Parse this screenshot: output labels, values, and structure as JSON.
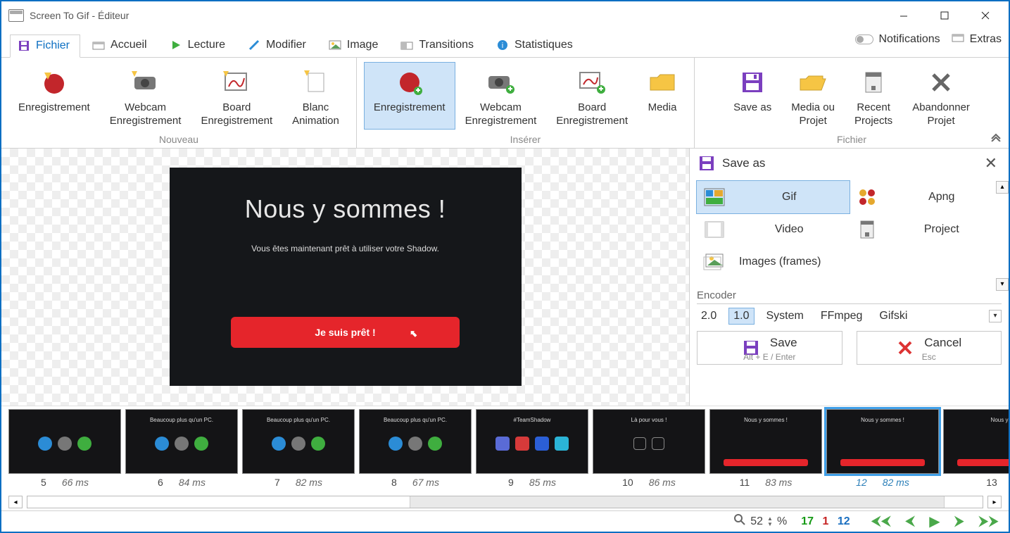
{
  "window": {
    "title": "Screen To Gif - Éditeur"
  },
  "tabs": {
    "fichier": "Fichier",
    "accueil": "Accueil",
    "lecture": "Lecture",
    "modifier": "Modifier",
    "image": "Image",
    "transitions": "Transitions",
    "statistiques": "Statistiques"
  },
  "ribbon_right": {
    "notifications": "Notifications",
    "extras": "Extras"
  },
  "ribbon": {
    "nouveau": {
      "label": "Nouveau",
      "items": {
        "rec": "Enregistrement",
        "webcam_l1": "Webcam",
        "webcam_l2": "Enregistrement",
        "board_l1": "Board",
        "board_l2": "Enregistrement",
        "blanc_l1": "Blanc",
        "blanc_l2": "Animation"
      }
    },
    "inserer": {
      "label": "Insérer",
      "items": {
        "rec": "Enregistrement",
        "webcam_l1": "Webcam",
        "webcam_l2": "Enregistrement",
        "board_l1": "Board",
        "board_l2": "Enregistrement",
        "media": "Media"
      }
    },
    "fichier_grp": {
      "label": "Fichier",
      "items": {
        "saveas": "Save as",
        "media_l1": "Media ou",
        "media_l2": "Projet",
        "recent_l1": "Recent",
        "recent_l2": "Projects",
        "abandon_l1": "Abandonner",
        "abandon_l2": "Projet"
      }
    }
  },
  "preview": {
    "heading": "Nous y sommes !",
    "sub": "Vous êtes maintenant prêt à utiliser votre Shadow.",
    "button": "Je suis prêt !"
  },
  "side": {
    "title": "Save as",
    "formats": {
      "gif": "Gif",
      "apng": "Apng",
      "video": "Video",
      "project": "Project",
      "images": "Images (frames)"
    },
    "encoder_label": "Encoder",
    "encoders": {
      "v20": "2.0",
      "v10": "1.0",
      "system": "System",
      "ffmpeg": "FFmpeg",
      "gifski": "Gifski"
    },
    "save": {
      "label": "Save",
      "hint": "Alt + E / Enter"
    },
    "cancel": {
      "label": "Cancel",
      "hint": "Esc"
    }
  },
  "frames": [
    {
      "idx": "5",
      "ms": "66 ms",
      "type": "icons3b"
    },
    {
      "idx": "6",
      "ms": "84 ms",
      "type": "icons3b",
      "title": "Beaucoup plus qu'un PC."
    },
    {
      "idx": "7",
      "ms": "82 ms",
      "type": "icons3",
      "title": "Beaucoup plus qu'un PC."
    },
    {
      "idx": "8",
      "ms": "67 ms",
      "type": "icons3",
      "title": "Beaucoup plus qu'un PC."
    },
    {
      "idx": "9",
      "ms": "85 ms",
      "type": "social",
      "title": "#TeamShadow"
    },
    {
      "idx": "10",
      "ms": "86 ms",
      "type": "plain",
      "title": "Là pour vous !"
    },
    {
      "idx": "11",
      "ms": "83 ms",
      "type": "final",
      "title": "Nous y sommes !"
    },
    {
      "idx": "12",
      "ms": "82 ms",
      "type": "final2",
      "title": "Nous y sommes !",
      "selected": true
    },
    {
      "idx": "13",
      "ms": "",
      "type": "final2",
      "title": "Nous y"
    }
  ],
  "status": {
    "zoom": "52",
    "pct": "%",
    "c1": "17",
    "c2": "1",
    "c3": "12"
  }
}
